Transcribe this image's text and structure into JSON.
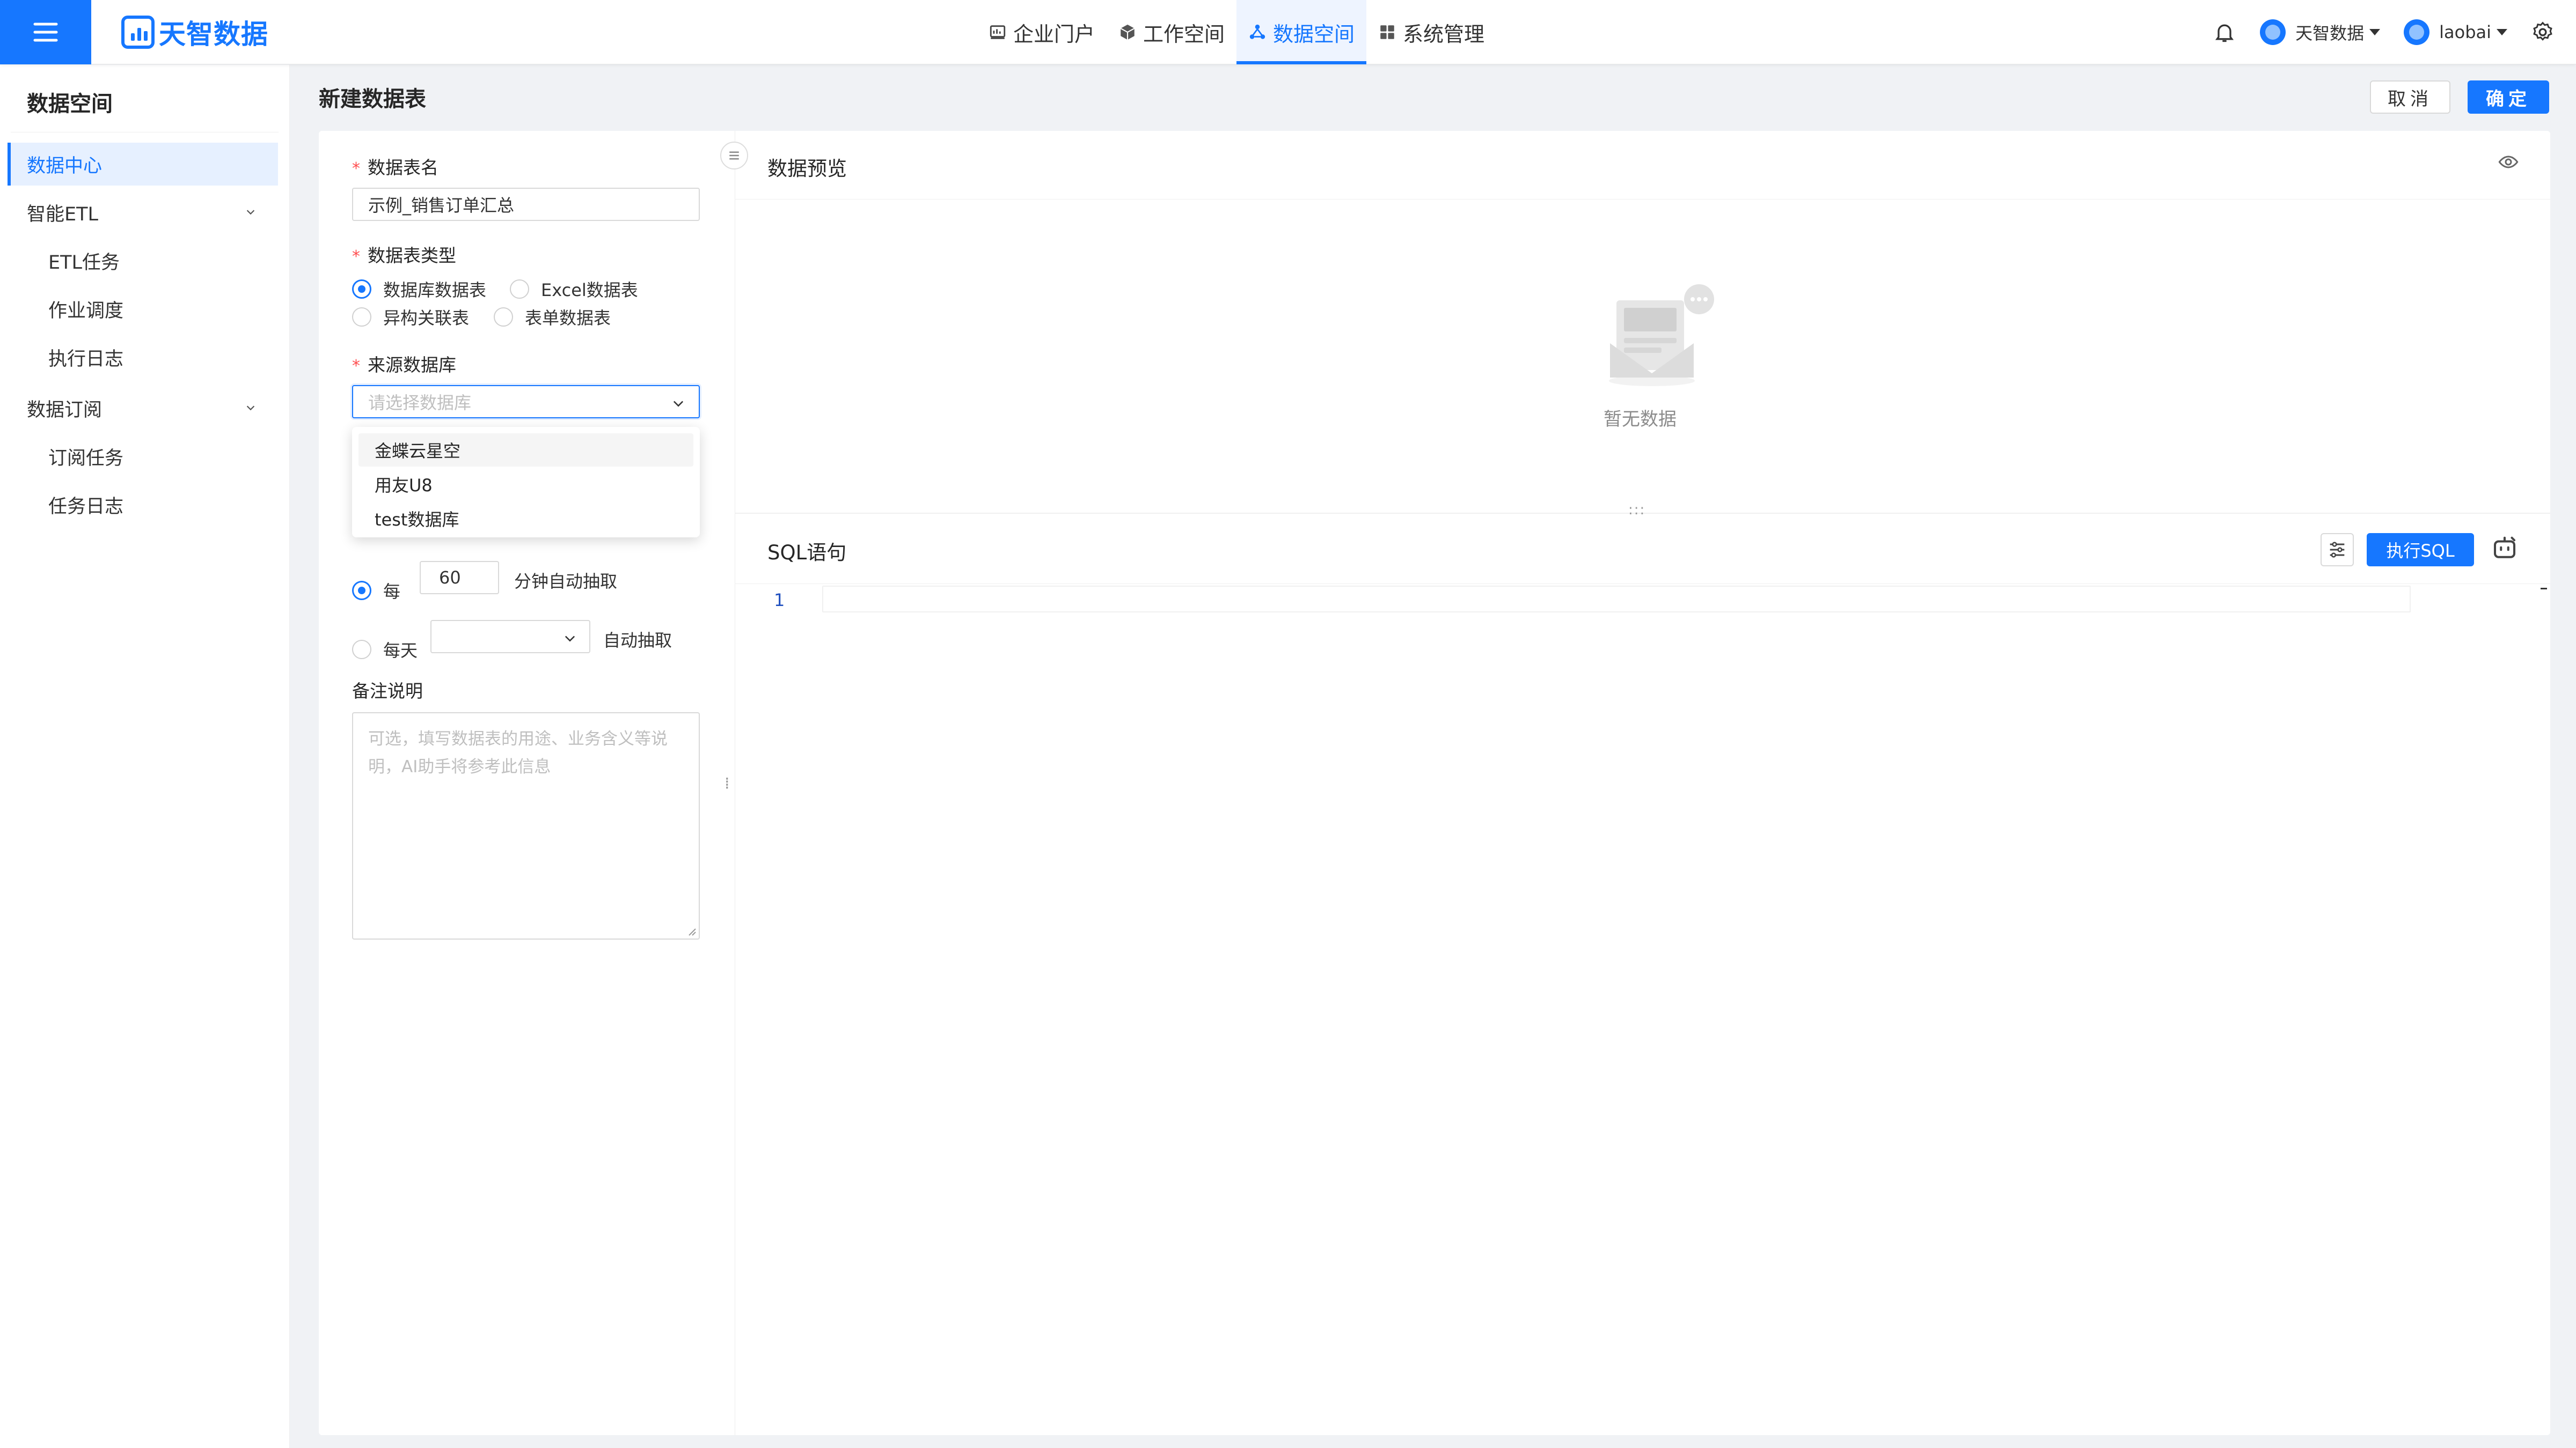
{
  "app": {
    "logo_text": "天智数据"
  },
  "nav": {
    "items": [
      {
        "label": "企业门户",
        "icon": "portal-icon",
        "active": false
      },
      {
        "label": "工作空间",
        "icon": "cube-icon",
        "active": false
      },
      {
        "label": "数据空间",
        "icon": "share-nodes-icon",
        "active": true
      },
      {
        "label": "系统管理",
        "icon": "grid-icon",
        "active": false
      }
    ]
  },
  "header_right": {
    "org_name": "天智数据",
    "username": "laobai"
  },
  "sidebar": {
    "title": "数据空间",
    "items": [
      {
        "label": "数据中心",
        "active": true
      },
      {
        "label": "智能ETL",
        "expandable": true
      },
      {
        "label": "ETL任务",
        "sub": true
      },
      {
        "label": "作业调度",
        "sub": true
      },
      {
        "label": "执行日志",
        "sub": true
      },
      {
        "label": "数据订阅",
        "expandable": true
      },
      {
        "label": "订阅任务",
        "sub": true
      },
      {
        "label": "任务日志",
        "sub": true
      }
    ]
  },
  "page": {
    "title": "新建数据表",
    "cancel_label": "取消",
    "ok_label": "确定"
  },
  "form": {
    "name_label": "数据表名",
    "name_value": "示例_销售订单汇总",
    "type_label": "数据表类型",
    "type_options": [
      {
        "label": "数据库数据表",
        "selected": true
      },
      {
        "label": "Excel数据表",
        "selected": false
      },
      {
        "label": "异构关联表",
        "selected": false
      },
      {
        "label": "表单数据表",
        "selected": false
      }
    ],
    "source_label": "来源数据库",
    "source_placeholder": "请选择数据库",
    "source_options": [
      "金蝶云星空",
      "用友U8",
      "test数据库"
    ],
    "schedule": {
      "every_label": "每",
      "every_value": "60",
      "every_suffix": "分钟自动抽取",
      "daily_label": "每天",
      "daily_suffix": "自动抽取"
    },
    "remark_label": "备注说明",
    "remark_placeholder": "可选，填写数据表的用途、业务含义等说明，AI助手将参考此信息"
  },
  "preview": {
    "title": "数据预览",
    "empty_text": "暂无数据"
  },
  "sql": {
    "title": "SQL语句",
    "exec_label": "执行SQL",
    "line_number": "1"
  },
  "colors": {
    "primary": "#1677ff",
    "required": "#ff4d4f"
  }
}
